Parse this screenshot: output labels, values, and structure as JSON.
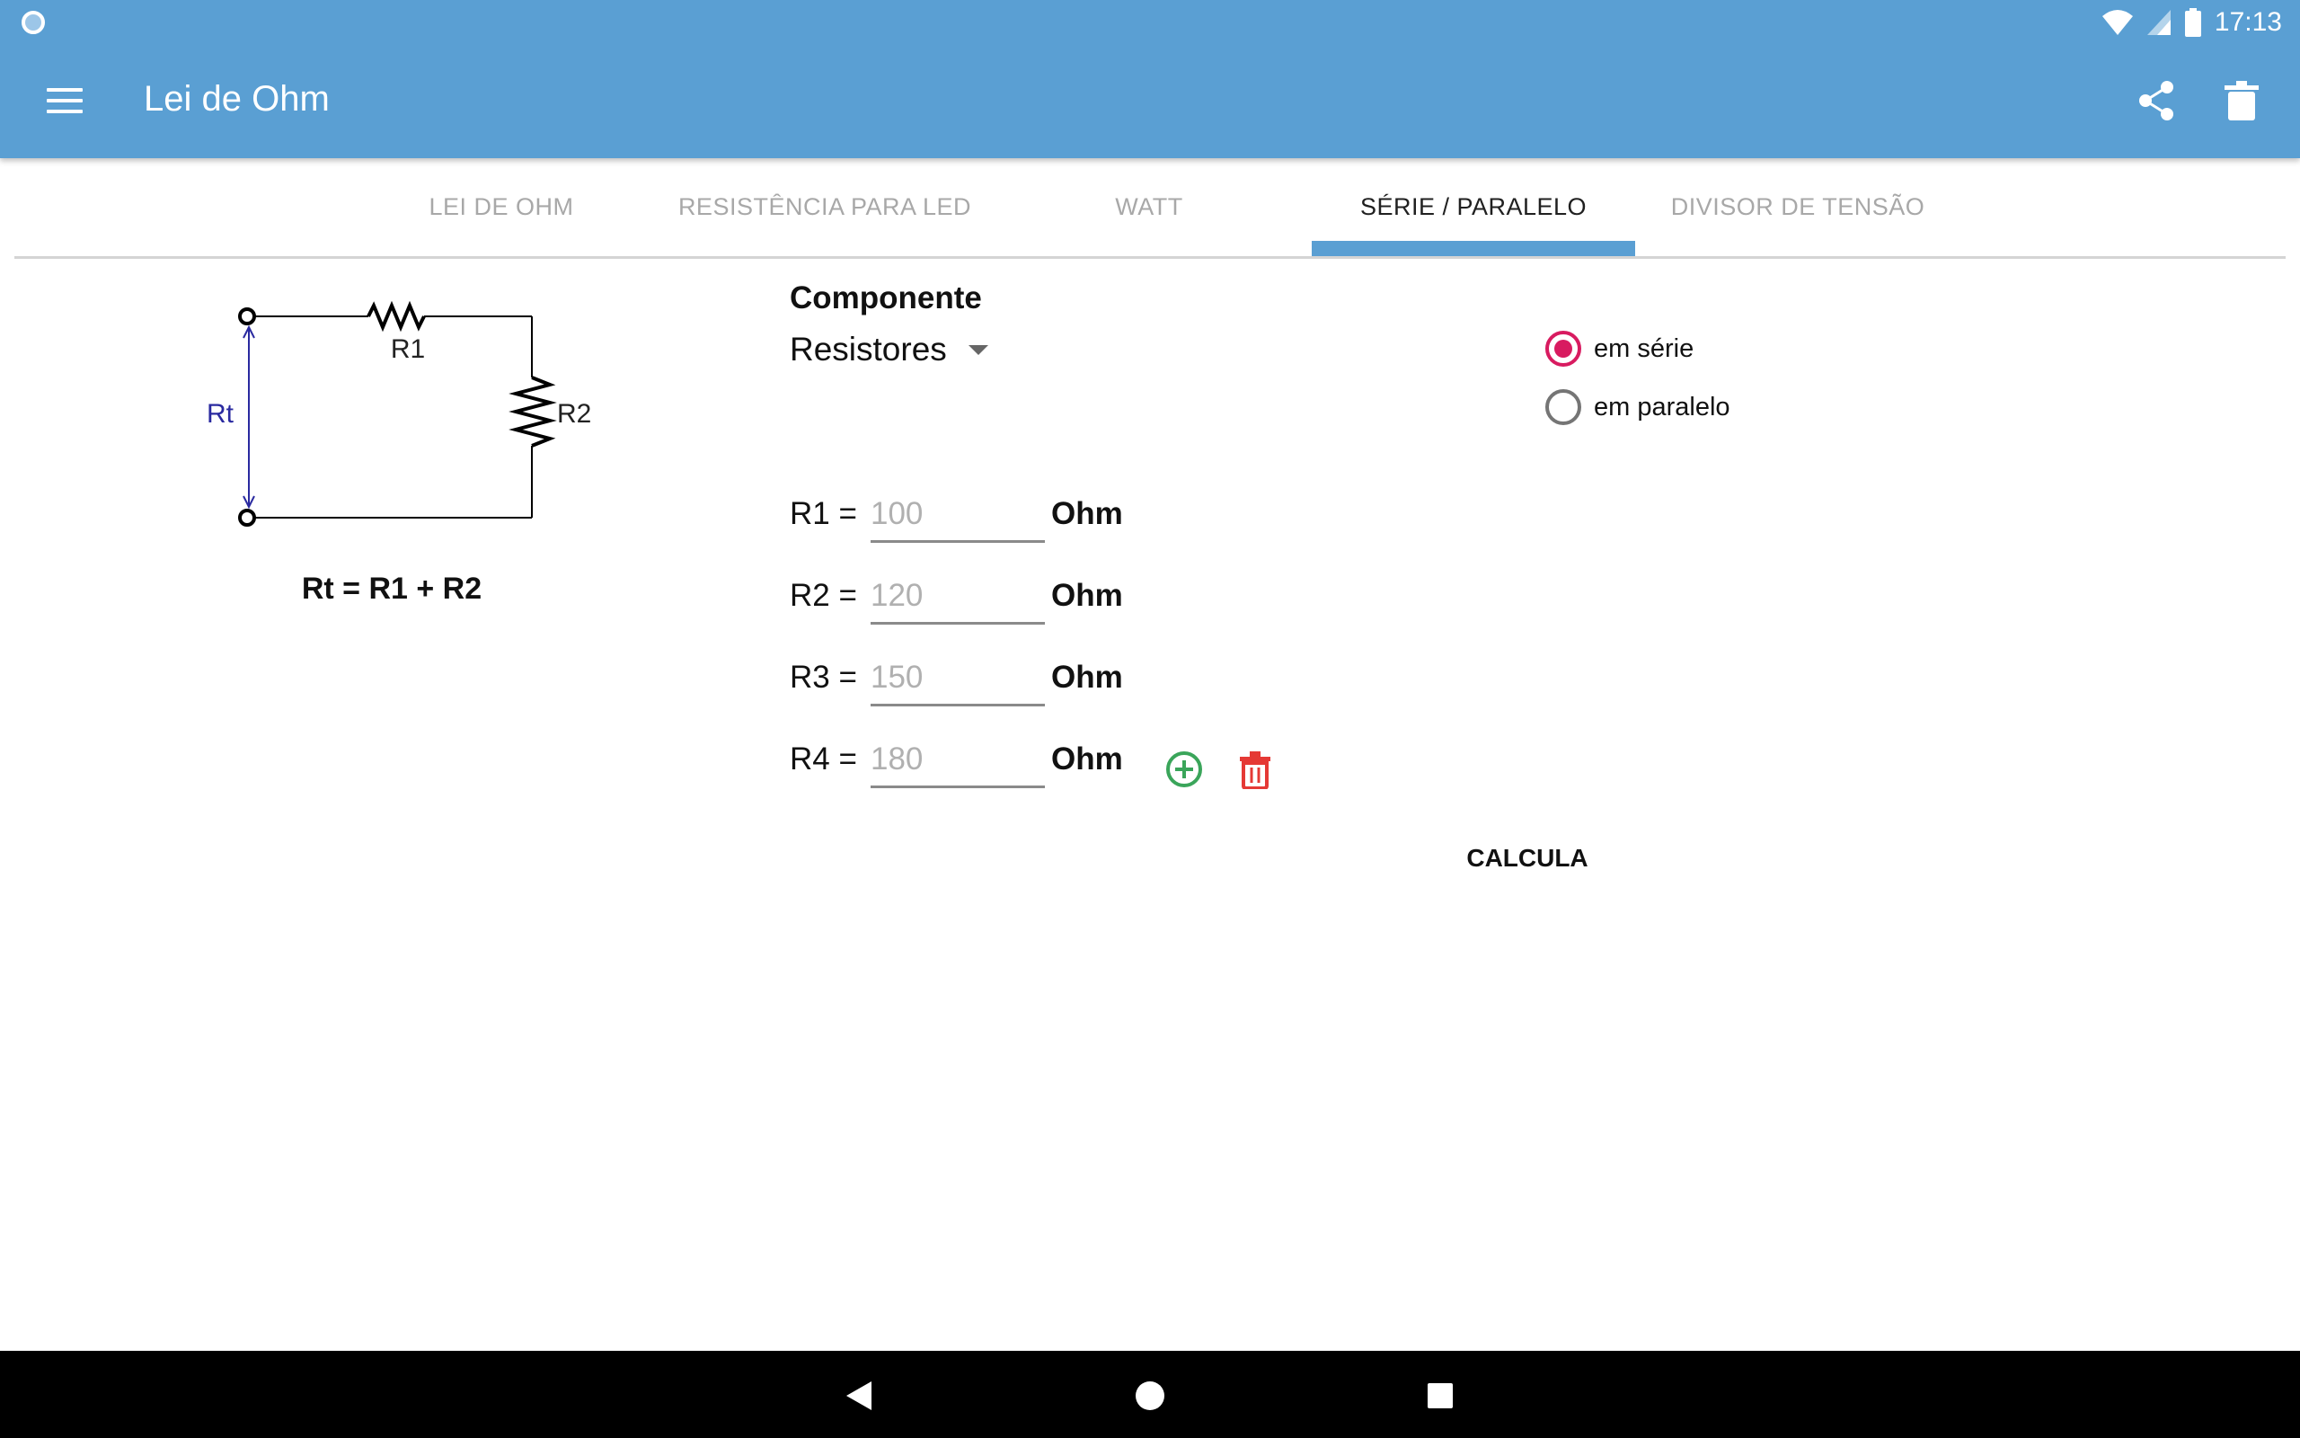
{
  "status_bar": {
    "time": "17:13"
  },
  "app_bar": {
    "title": "Lei de Ohm"
  },
  "tabs": [
    {
      "label": "LEI DE OHM"
    },
    {
      "label": "RESISTÊNCIA PARA LED"
    },
    {
      "label": "WATT"
    },
    {
      "label": "SÉRIE / PARALELO",
      "active": true
    },
    {
      "label": "DIVISOR DE TENSÃO"
    }
  ],
  "diagram": {
    "r1_label": "R1",
    "r2_label": "R2",
    "rt_label": "Rt",
    "formula": "Rt = R1 + R2"
  },
  "component": {
    "label": "Componente",
    "selected": "Resistores"
  },
  "mode": {
    "options": [
      {
        "label": "em série",
        "checked": true
      },
      {
        "label": "em paralelo",
        "checked": false
      }
    ]
  },
  "resistors": [
    {
      "label": "R1 =",
      "value": "",
      "placeholder": "100",
      "unit": "Ohm"
    },
    {
      "label": "R2 =",
      "value": "",
      "placeholder": "120",
      "unit": "Ohm"
    },
    {
      "label": "R3 =",
      "value": "",
      "placeholder": "150",
      "unit": "Ohm"
    },
    {
      "label": "R4 =",
      "value": "",
      "placeholder": "180",
      "unit": "Ohm"
    }
  ],
  "actions": {
    "calculate_label": "CALCULA"
  },
  "colors": {
    "primary": "#5a9fd3",
    "radio_accent": "#d81b60",
    "add_icon": "#3aa55a",
    "delete_icon": "#e53935",
    "diagram_rt": "#2a2aa0"
  }
}
